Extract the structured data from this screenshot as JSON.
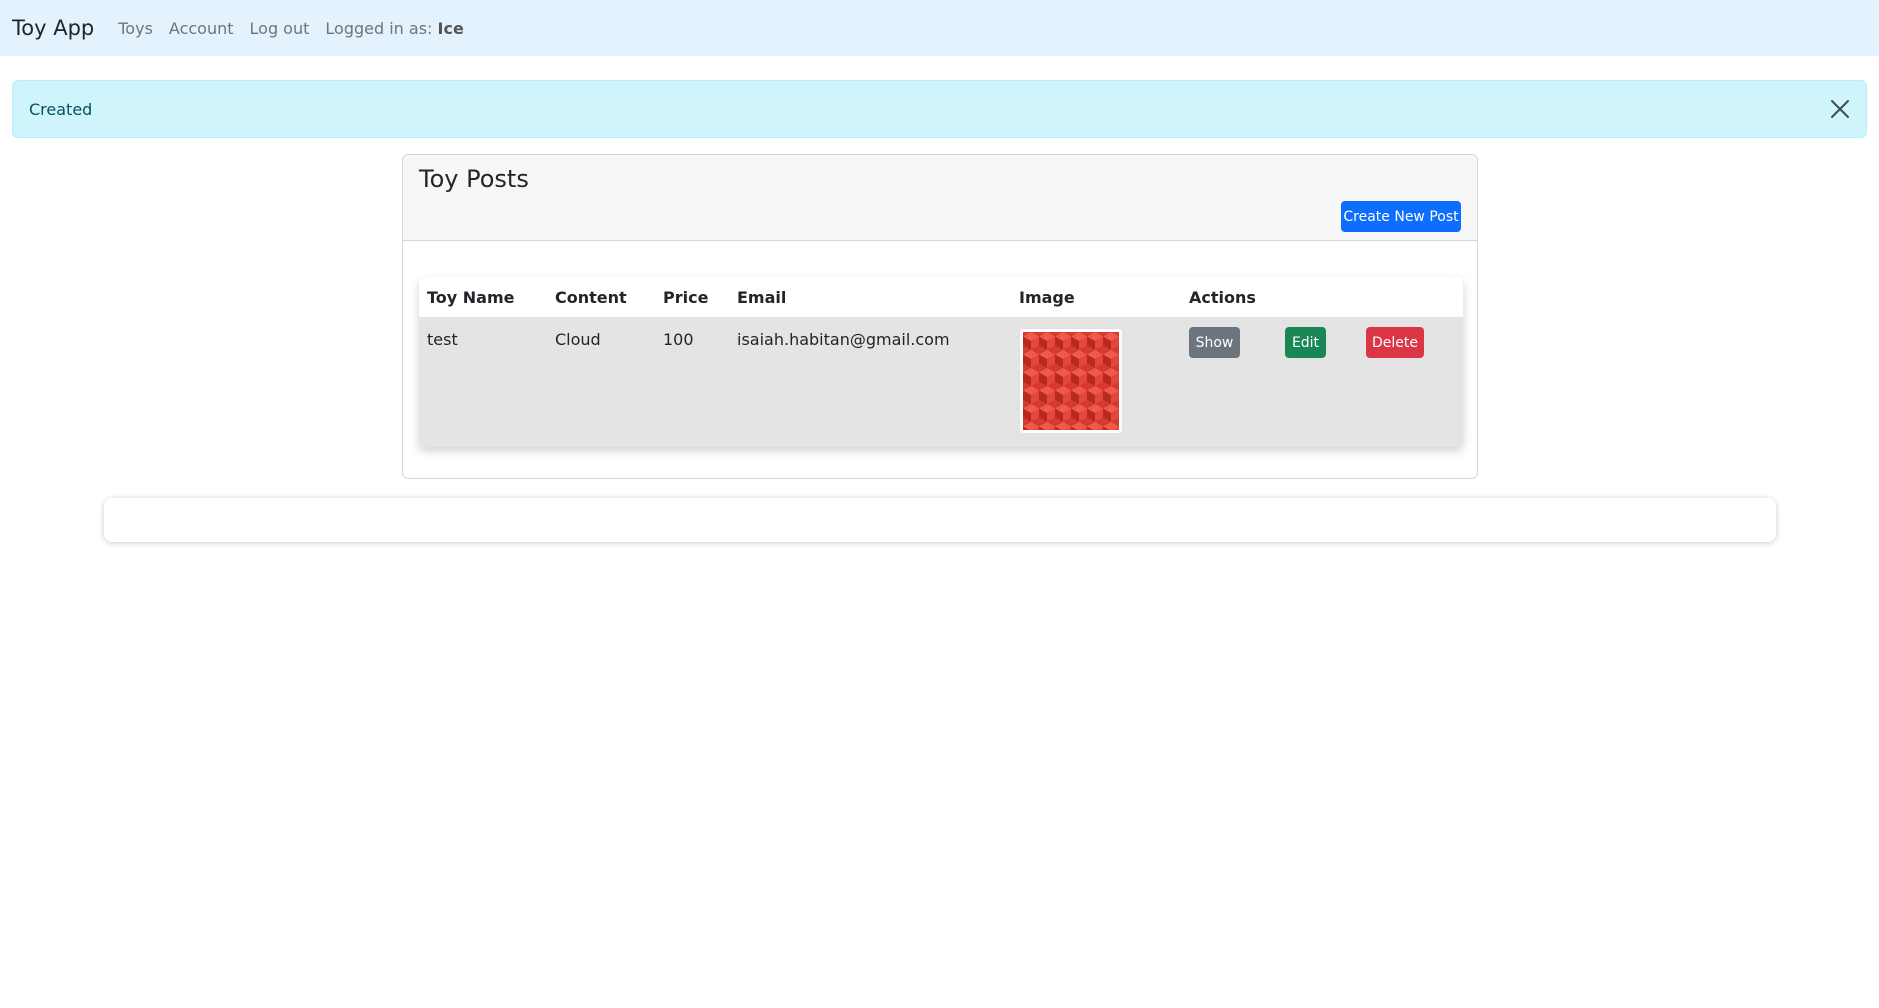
{
  "navbar": {
    "brand": "Toy App",
    "links": [
      "Toys",
      "Account",
      "Log out"
    ],
    "logged_in_prefix": "Logged in as:",
    "username": "Ice",
    "bg_color": "#e3f2fd"
  },
  "alert": {
    "message": "Created",
    "close_icon": "close-icon"
  },
  "posts_card": {
    "title": "Toy Posts",
    "create_button_label": "Create New Post"
  },
  "table": {
    "headers": [
      "Toy Name",
      "Content",
      "Price",
      "Email",
      "Image",
      "Actions"
    ],
    "rows": [
      {
        "toy_name": "test",
        "content": "Cloud",
        "price": "100",
        "email": "isaiah.habitan@gmail.com",
        "image_icon": "red-cube-pattern-image",
        "actions": {
          "show_label": "Show",
          "edit_label": "Edit",
          "delete_label": "Delete"
        }
      }
    ]
  },
  "colors": {
    "primary": "#0d6efd",
    "secondary": "#6c757d",
    "success": "#198754",
    "danger": "#dc3545",
    "alert_bg": "#cff4fc",
    "alert_text": "#055160"
  }
}
